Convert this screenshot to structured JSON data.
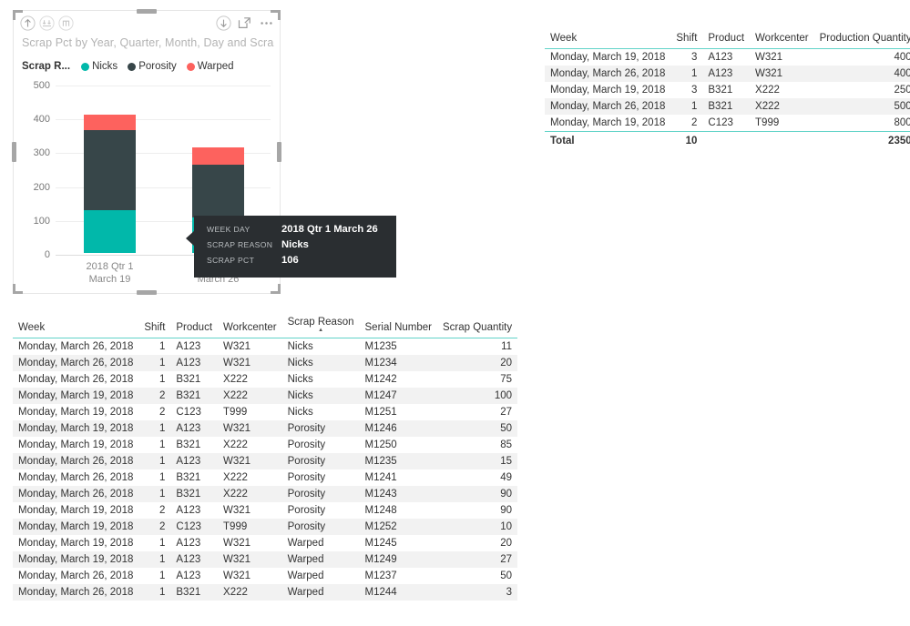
{
  "chart_visual": {
    "title": "Scrap Pct by Year, Quarter, Month, Day and Scra...",
    "legend_title": "Scrap R...",
    "header_icons": [
      {
        "name": "drill-up-icon",
        "label": "Drill up"
      },
      {
        "name": "drill-down-expand-icon",
        "label": "Expand all down one level"
      },
      {
        "name": "drill-hierarchy-icon",
        "label": "Go to next level"
      },
      {
        "name": "drill-mode-toggle-icon",
        "label": "Drill mode"
      },
      {
        "name": "focus-mode-icon",
        "label": "Focus mode"
      },
      {
        "name": "more-options-icon",
        "label": "More options"
      }
    ],
    "tooltip": {
      "rows": [
        {
          "key": "WEEK DAY",
          "value": "2018 Qtr 1 March 26"
        },
        {
          "key": "SCRAP REASON",
          "value": "Nicks"
        },
        {
          "key": "SCRAP PCT",
          "value": "106"
        }
      ]
    }
  },
  "chart_data": {
    "type": "bar",
    "subtype": "stacked-column",
    "title": "Scrap Pct by Year, Quarter, Month, Day and Scra...",
    "xlabel": "",
    "ylabel": "",
    "ylim": [
      0,
      500
    ],
    "yticks": [
      0,
      100,
      200,
      300,
      400,
      500
    ],
    "grid": true,
    "legend_position": "top",
    "legend_title": "Scrap R...",
    "categories": [
      "2018 Qtr 1 March 19",
      "2018 Qtr 1 March 26"
    ],
    "category_lines": [
      [
        "2018 Qtr 1",
        "March 19"
      ],
      [
        "2018 Qtr 1",
        "March 26"
      ]
    ],
    "series": [
      {
        "name": "Nicks",
        "color": "#01B8AA",
        "values": [
          127,
          106
        ]
      },
      {
        "name": "Porosity",
        "color": "#374649",
        "values": [
          235,
          154
        ]
      },
      {
        "name": "Warped",
        "color": "#FD625E",
        "values": [
          47,
          53
        ]
      }
    ],
    "totals": [
      409,
      313
    ]
  },
  "table_top": {
    "columns": [
      {
        "label": "Week",
        "align": "left"
      },
      {
        "label": "Shift",
        "align": "right"
      },
      {
        "label": "Product",
        "align": "left"
      },
      {
        "label": "Workcenter",
        "align": "left"
      },
      {
        "label": "Production Quantity",
        "align": "right"
      }
    ],
    "rows": [
      [
        "Monday, March 19, 2018",
        "3",
        "A123",
        "W321",
        "400"
      ],
      [
        "Monday, March 26, 2018",
        "1",
        "A123",
        "W321",
        "400"
      ],
      [
        "Monday, March 19, 2018",
        "3",
        "B321",
        "X222",
        "250"
      ],
      [
        "Monday, March 26, 2018",
        "1",
        "B321",
        "X222",
        "500"
      ],
      [
        "Monday, March 19, 2018",
        "2",
        "C123",
        "T999",
        "800"
      ]
    ],
    "total_row": [
      "Total",
      "10",
      "",
      "",
      "2350"
    ]
  },
  "table_bottom": {
    "columns": [
      {
        "label": "Week",
        "align": "left",
        "sorted": false
      },
      {
        "label": "Shift",
        "align": "right",
        "sorted": false
      },
      {
        "label": "Product",
        "align": "left",
        "sorted": false
      },
      {
        "label": "Workcenter",
        "align": "left",
        "sorted": false
      },
      {
        "label": "Scrap Reason",
        "align": "left",
        "sorted": true,
        "sort_direction": "asc"
      },
      {
        "label": "Serial Number",
        "align": "left",
        "sorted": false
      },
      {
        "label": "Scrap Quantity",
        "align": "right",
        "sorted": false
      }
    ],
    "rows": [
      [
        "Monday, March 26, 2018",
        "1",
        "A123",
        "W321",
        "Nicks",
        "M1235",
        "11"
      ],
      [
        "Monday, March 26, 2018",
        "1",
        "A123",
        "W321",
        "Nicks",
        "M1234",
        "20"
      ],
      [
        "Monday, March 26, 2018",
        "1",
        "B321",
        "X222",
        "Nicks",
        "M1242",
        "75"
      ],
      [
        "Monday, March 19, 2018",
        "2",
        "B321",
        "X222",
        "Nicks",
        "M1247",
        "100"
      ],
      [
        "Monday, March 19, 2018",
        "2",
        "C123",
        "T999",
        "Nicks",
        "M1251",
        "27"
      ],
      [
        "Monday, March 19, 2018",
        "1",
        "A123",
        "W321",
        "Porosity",
        "M1246",
        "50"
      ],
      [
        "Monday, March 19, 2018",
        "1",
        "B321",
        "X222",
        "Porosity",
        "M1250",
        "85"
      ],
      [
        "Monday, March 26, 2018",
        "1",
        "A123",
        "W321",
        "Porosity",
        "M1235",
        "15"
      ],
      [
        "Monday, March 26, 2018",
        "1",
        "B321",
        "X222",
        "Porosity",
        "M1241",
        "49"
      ],
      [
        "Monday, March 26, 2018",
        "1",
        "B321",
        "X222",
        "Porosity",
        "M1243",
        "90"
      ],
      [
        "Monday, March 19, 2018",
        "2",
        "A123",
        "W321",
        "Porosity",
        "M1248",
        "90"
      ],
      [
        "Monday, March 19, 2018",
        "2",
        "C123",
        "T999",
        "Porosity",
        "M1252",
        "10"
      ],
      [
        "Monday, March 19, 2018",
        "1",
        "A123",
        "W321",
        "Warped",
        "M1245",
        "20"
      ],
      [
        "Monday, March 19, 2018",
        "1",
        "A123",
        "W321",
        "Warped",
        "M1249",
        "27"
      ],
      [
        "Monday, March 26, 2018",
        "1",
        "A123",
        "W321",
        "Warped",
        "M1237",
        "50"
      ],
      [
        "Monday, March 26, 2018",
        "1",
        "B321",
        "X222",
        "Warped",
        "M1244",
        "3"
      ]
    ]
  },
  "colors": {
    "accent_teal": "#01B8AA",
    "series_dark": "#374649",
    "series_red": "#FD625E",
    "table_rule": "#61d3c8",
    "alt_row": "#f2f2f2"
  }
}
